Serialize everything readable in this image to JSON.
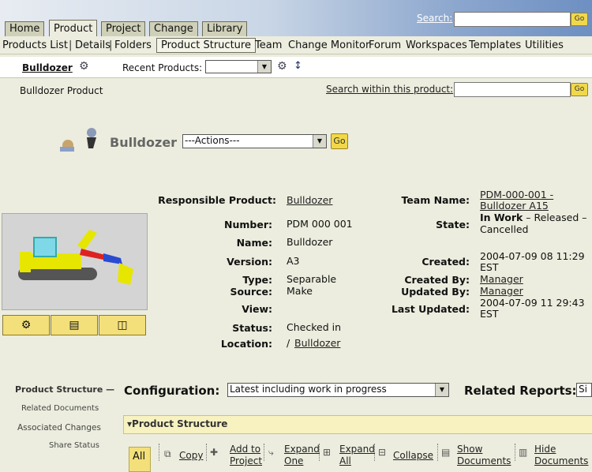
{
  "header": {
    "tabs": [
      "Home",
      "Product",
      "Project",
      "Change",
      "Library"
    ],
    "active_tab": "Product",
    "search_label": "Search:",
    "search_value": "",
    "go_label": "Go"
  },
  "subnav": {
    "items": [
      "Products List",
      "Details",
      "Folders",
      "Product Structure",
      "Team",
      "Change Monitor",
      "Forum",
      "Workspaces",
      "Templates",
      "Utilities"
    ],
    "selected": "Product Structure"
  },
  "context": {
    "product_link": "Bulldozer",
    "recent_label": "Recent Products:",
    "recent_value": ""
  },
  "page": {
    "subtitle": "Bulldozer Product",
    "search_within_label": "Search within this product:",
    "search_within_value": "",
    "title": "Bulldozer",
    "actions_value": "---Actions---",
    "go_label": "Go"
  },
  "details": {
    "left": [
      {
        "label": "Responsible Product:",
        "value": "Bulldozer",
        "link": true
      },
      {
        "label": "Number:",
        "value": "PDM 000 001",
        "link": false
      },
      {
        "label": "Name:",
        "value": "Bulldozer",
        "link": false
      },
      {
        "label": "Version:",
        "value": "A3",
        "link": false
      },
      {
        "label": "Type:",
        "value": "Separable",
        "link": false
      },
      {
        "label": "Source:",
        "value": "Make",
        "link": false
      },
      {
        "label": "View:",
        "value": "",
        "link": false
      },
      {
        "label": "Status:",
        "value": "Checked in",
        "link": false
      },
      {
        "label": "Location:",
        "value_prefix": "/",
        "value": "Bulldozer",
        "link": true
      }
    ],
    "right": {
      "team_label": "Team Name:",
      "team_line1": "PDM-000-001 -",
      "team_line2": "Bulldozer A15",
      "state_label": "State:",
      "state_current": "In Work",
      "state_rest": " – Released –",
      "state_line2": "Cancelled",
      "created_label": "Created:",
      "created_line1": "2004-07-09 08 11:29",
      "created_line2": "EST",
      "created_by_label": "Created By:",
      "created_by": "Manager",
      "updated_by_label": "Updated By:",
      "updated_by": "Manager",
      "last_updated_label": "Last Updated:",
      "last_updated_line1": "2004-07-09 11 29:43",
      "last_updated_line2": "EST"
    }
  },
  "leftnav": {
    "items": [
      "Product Structure",
      "Related Documents",
      "Associated Changes",
      "Share Status"
    ]
  },
  "config": {
    "label": "Configuration:",
    "value": "Latest including work in progress",
    "related_label": "Related Reports:",
    "related_value": "Si"
  },
  "structure": {
    "header": "Product Structure",
    "all_label": "All",
    "tools": [
      {
        "l1": "Copy",
        "l2": ""
      },
      {
        "l1": "Add to",
        "l2": "Project"
      },
      {
        "l1": "Expand",
        "l2": "One"
      },
      {
        "l1": "Expand",
        "l2": "All"
      },
      {
        "l1": "Collapse",
        "l2": ""
      },
      {
        "l1": "Show",
        "l2": "Documents"
      },
      {
        "l1": "Hide",
        "l2": "Documents"
      }
    ]
  }
}
